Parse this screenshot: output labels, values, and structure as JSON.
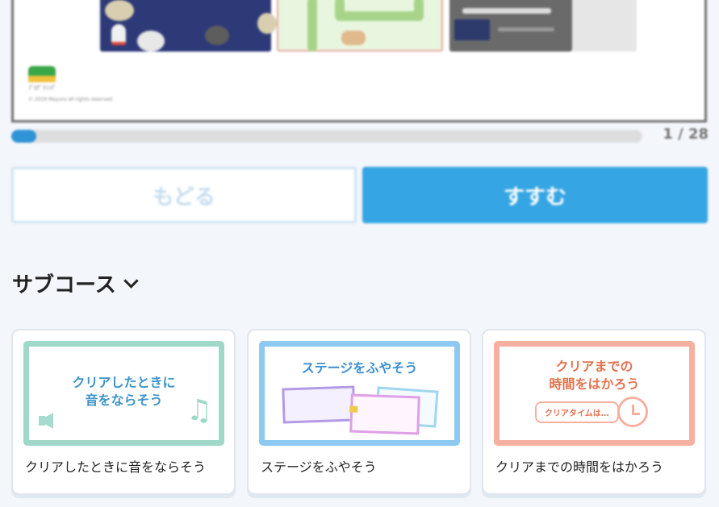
{
  "slide": {
    "logo_text": "ﾌﾟﾛｸﾞﾗﾐﾝｸﾞ",
    "copyright": "© 2019 Mayura all rights reserved."
  },
  "progress": {
    "current": 1,
    "total": 28,
    "label": "1 / 28",
    "fraction": 0.036
  },
  "nav": {
    "back_label": "もどる",
    "next_label": "すすむ"
  },
  "subcourse": {
    "title": "サブコース",
    "cards": [
      {
        "art_title": "クリアしたときに\n音をならそう",
        "caption": "クリアしたときに音をならそう"
      },
      {
        "art_title": "ステージをふやそう",
        "caption": "ステージをふやそう"
      },
      {
        "art_title": "クリアまでの\n時間をはかろう",
        "pill": "クリアタイムは…",
        "caption": "クリアまでの時間をはかろう"
      }
    ]
  },
  "colors": {
    "accent": "#36a5e3",
    "progress": "#2f93d6",
    "card1_border": "#9fd8c9",
    "card2_border": "#8dc9f1",
    "card3_border": "#f6b0a0"
  }
}
